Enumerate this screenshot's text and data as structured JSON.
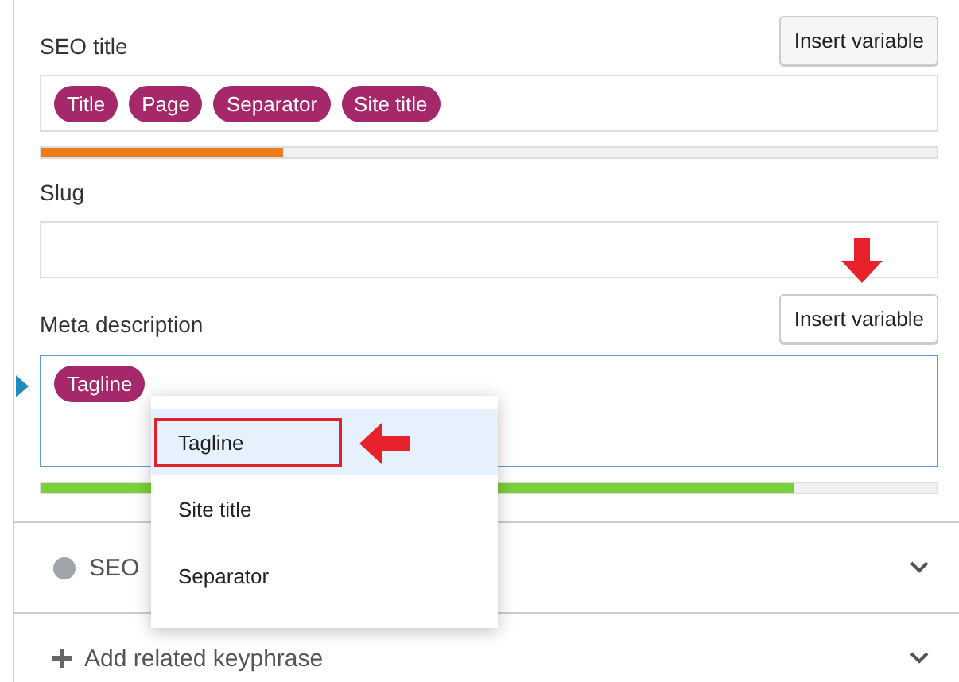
{
  "seo_title": {
    "label": "SEO title",
    "button": "Insert variable",
    "pills": [
      "Title",
      "Page",
      "Separator",
      "Site title"
    ],
    "meter": {
      "level": 0.27,
      "color": "#ee7c1b"
    }
  },
  "slug": {
    "label": "Slug"
  },
  "meta_description": {
    "label": "Meta description",
    "button": "Insert variable",
    "focused": true,
    "pills": [
      "Tagline"
    ],
    "meter": {
      "level": 0.84,
      "color": "#7ad03a"
    }
  },
  "dropdown": {
    "items": [
      {
        "label": "Tagline",
        "selected": true
      },
      {
        "label": "Site title",
        "selected": false
      },
      {
        "label": "Separator",
        "selected": false
      }
    ]
  },
  "sections": [
    {
      "kind": "dot",
      "label": "SEO",
      "expanded": false
    },
    {
      "kind": "plus",
      "label": "Add related keyphrase",
      "expanded": false
    }
  ]
}
